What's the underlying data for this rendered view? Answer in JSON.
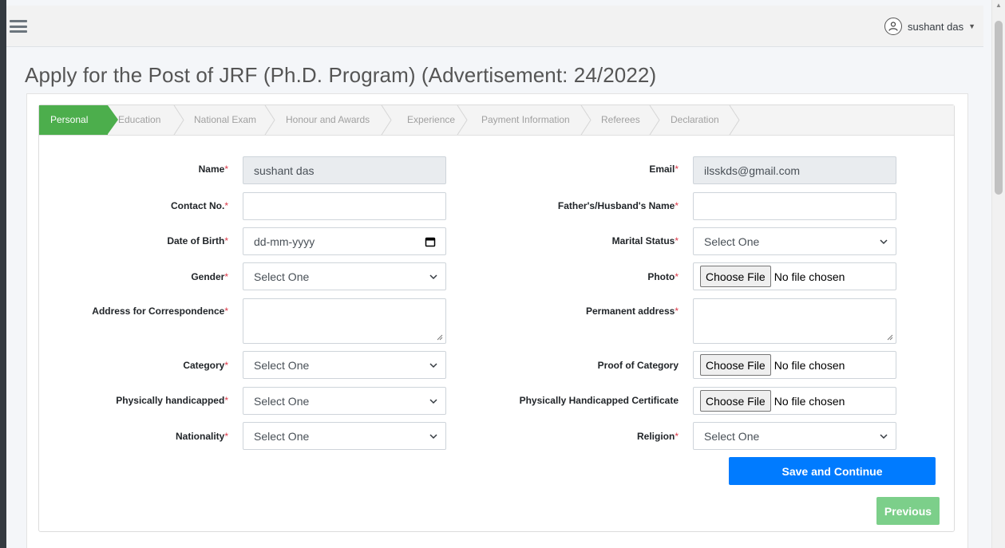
{
  "header": {
    "user_name": "sushant das",
    "avatar_icon": "user-avatar-icon",
    "menu_icon": "hamburger-menu-icon"
  },
  "page": {
    "title": "Apply for the Post of JRF (Ph.D. Program) (Advertisement: 24/2022)"
  },
  "steps": [
    {
      "label": "Personal",
      "active": true
    },
    {
      "label": "Education",
      "active": false
    },
    {
      "label": "National Exam",
      "active": false
    },
    {
      "label": "Honour and Awards",
      "active": false
    },
    {
      "label": "Experience",
      "active": false
    },
    {
      "label": "Payment Information",
      "active": false
    },
    {
      "label": "Referees",
      "active": false
    },
    {
      "label": "Declaration",
      "active": false
    }
  ],
  "form": {
    "required_mark": "*",
    "name": {
      "label": "Name",
      "value": "sushant das"
    },
    "email": {
      "label": "Email",
      "value": "ilsskds@gmail.com"
    },
    "contact": {
      "label": "Contact No.",
      "value": ""
    },
    "father": {
      "label": "Father's/Husband's Name",
      "value": ""
    },
    "dob": {
      "label": "Date of Birth",
      "placeholder": "dd-mm-yyyy"
    },
    "marital": {
      "label": "Marital Status",
      "selected": "Select One"
    },
    "gender": {
      "label": "Gender",
      "selected": "Select One"
    },
    "photo": {
      "label": "Photo",
      "button": "Choose File",
      "status": "No file chosen"
    },
    "address_corr": {
      "label": "Address for Correspondence",
      "value": ""
    },
    "address_perm": {
      "label": "Permanent address",
      "value": ""
    },
    "category": {
      "label": "Category",
      "selected": "Select One"
    },
    "proof_category": {
      "label": "Proof of Category",
      "button": "Choose File",
      "status": "No file chosen"
    },
    "handicapped": {
      "label": "Physically handicapped",
      "selected": "Select One"
    },
    "handicapped_cert": {
      "label": "Physically Handicapped Certificate",
      "button": "Choose File",
      "status": "No file chosen"
    },
    "nationality": {
      "label": "Nationality",
      "selected": "Select One"
    },
    "religion": {
      "label": "Religion",
      "selected": "Select One"
    }
  },
  "actions": {
    "save_label": "Save and Continue",
    "previous_label": "Previous"
  },
  "colors": {
    "primary": "#007bff",
    "success": "#4cae4c",
    "success_light": "#7ccf8a",
    "required": "#dc3545",
    "sidebar": "#343a40"
  }
}
